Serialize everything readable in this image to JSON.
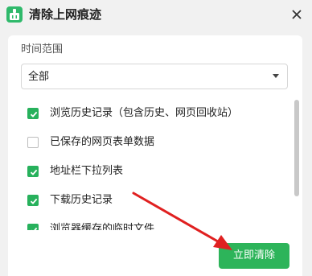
{
  "dialog": {
    "title": "清除上网痕迹",
    "app_icon": "broom-icon",
    "close_icon": "close-icon"
  },
  "time_range": {
    "label": "时间范围",
    "selected": "全部"
  },
  "items": [
    {
      "label": "浏览历史记录（包含历史、网页回收站）",
      "checked": true
    },
    {
      "label": "已保存的网页表单数据",
      "checked": false
    },
    {
      "label": "地址栏下拉列表",
      "checked": true
    },
    {
      "label": "下载历史记录",
      "checked": true
    },
    {
      "label": "浏览器缓存的临时文件",
      "checked": true
    }
  ],
  "actions": {
    "clear_label": "立即清除"
  },
  "colors": {
    "accent": "#2db45a",
    "annotation_arrow": "#e02020"
  }
}
